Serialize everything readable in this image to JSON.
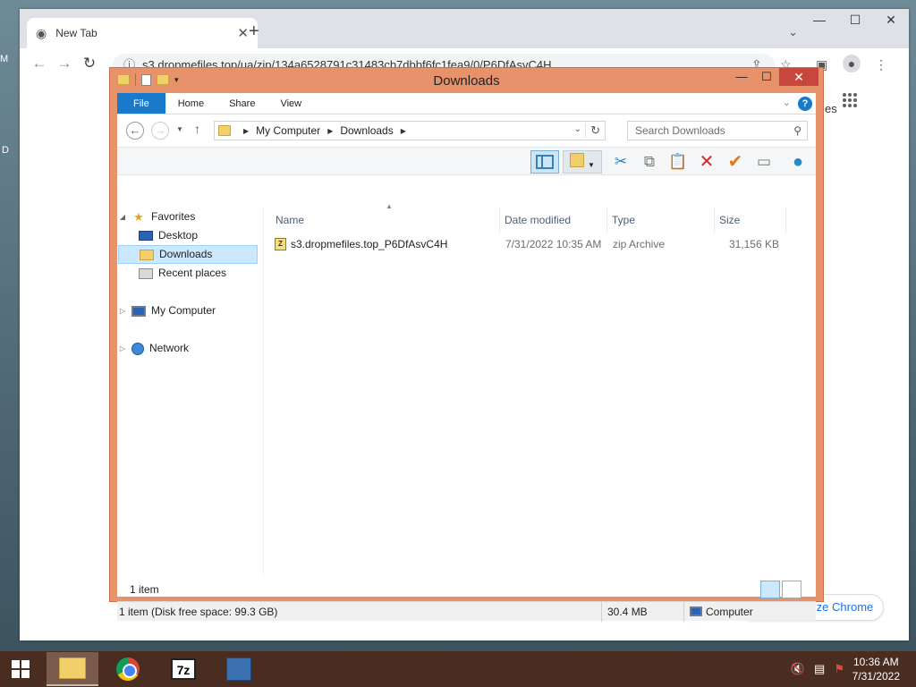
{
  "desktop": {
    "edge_top": "M",
    "edge_mid": "D"
  },
  "chrome": {
    "tab_title": "New Tab",
    "tab_close": "✕",
    "new_tab": "+",
    "win_min": "—",
    "win_max": "☐",
    "win_close": "✕",
    "url": "s3.dropmefiles.top/ua/zip/134a6528791c31483cb7dbbf6fc1fea9/0/P6DfAsvC4H",
    "right_snippet": "es",
    "customize": "Customize Chrome"
  },
  "explorer": {
    "title": "Downloads",
    "ribbon_tabs": [
      "File",
      "Home",
      "Share",
      "View"
    ],
    "address": [
      "My Computer",
      "Downloads"
    ],
    "search_placeholder": "Search Downloads",
    "nav": {
      "favorites": "Favorites",
      "desktop": "Desktop",
      "downloads": "Downloads",
      "recent": "Recent places",
      "computer": "My Computer",
      "network": "Network"
    },
    "columns": [
      "Name",
      "Date modified",
      "Type",
      "Size"
    ],
    "files": [
      {
        "name": "s3.dropmefiles.top_P6DfAsvC4H",
        "date": "7/31/2022 10:35 AM",
        "type": "zip Archive",
        "size": "31,156 KB"
      }
    ],
    "item_count": "1 item",
    "status": {
      "left": "1 item (Disk free space: 99.3 GB)",
      "size": "30.4 MB",
      "location": "Computer"
    }
  },
  "taskbar": {
    "time": "10:36 AM",
    "date": "7/31/2022",
    "sevenzip_label": "7z"
  }
}
